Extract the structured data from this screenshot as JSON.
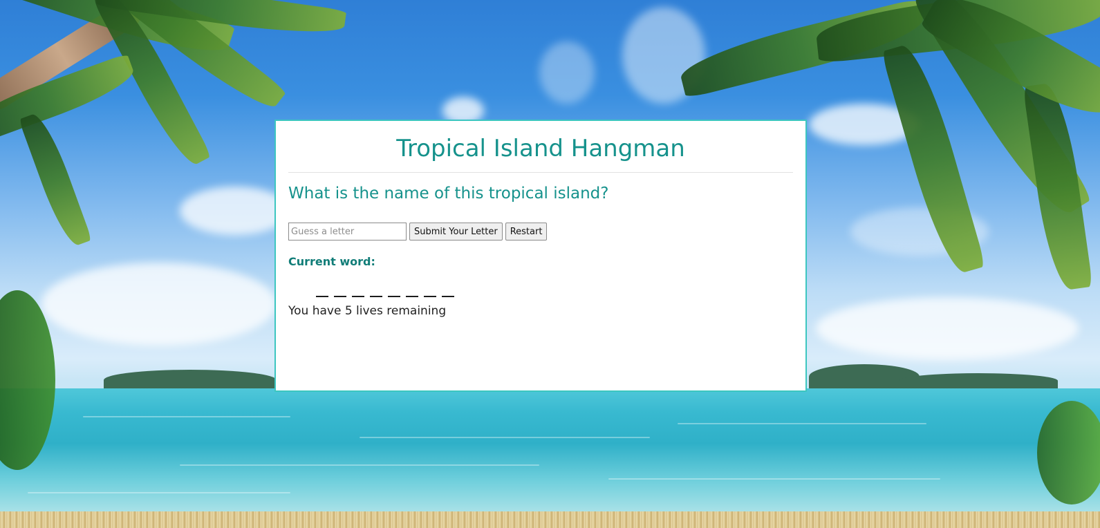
{
  "app": {
    "title": "Tropical Island Hangman"
  },
  "game": {
    "question": "What is the name of this tropical island?",
    "guess_placeholder": "Guess a letter",
    "guess_value": "",
    "submit_label": "Submit Your Letter",
    "restart_label": "Restart",
    "current_word_label": "Current word:",
    "word_blanks": [
      "_",
      "_",
      "_",
      "_",
      "_",
      "_",
      "_",
      "_"
    ],
    "lives_text": "You have 5 lives remaining"
  },
  "colors": {
    "accent": "#16928c",
    "card_border": "#3cc6c0",
    "label": "#117d78"
  }
}
